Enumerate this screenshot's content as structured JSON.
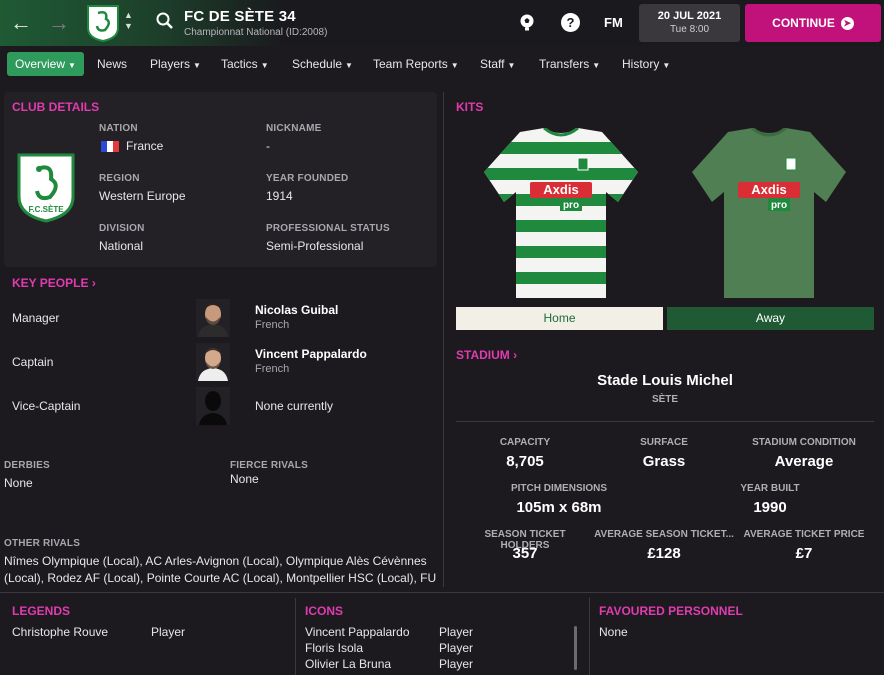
{
  "header": {
    "club_name": "FC DE SÈTE 34",
    "competition": "Championnat National (ID:2008)",
    "fm_label": "FM",
    "date": "20 JUL 2021",
    "day_time": "Tue 8:00",
    "continue_label": "CONTINUE"
  },
  "tabs": [
    {
      "label": "Overview"
    },
    {
      "label": "News"
    },
    {
      "label": "Players"
    },
    {
      "label": "Tactics"
    },
    {
      "label": "Schedule"
    },
    {
      "label": "Team Reports"
    },
    {
      "label": "Staff"
    },
    {
      "label": "Transfers"
    },
    {
      "label": "History"
    }
  ],
  "club_details": {
    "title": "CLUB DETAILS",
    "crest_text": "F.C.SÈTE",
    "nation_label": "NATION",
    "nation": "France",
    "nickname_label": "NICKNAME",
    "nickname": "-",
    "region_label": "REGION",
    "region": "Western Europe",
    "founded_label": "YEAR FOUNDED",
    "founded": "1914",
    "division_label": "DIVISION",
    "division": "National",
    "status_label": "PROFESSIONAL STATUS",
    "status": "Semi-Professional"
  },
  "key_people": {
    "title": "KEY PEOPLE",
    "people": [
      {
        "role": "Manager",
        "name": "Nicolas Guibal",
        "nationality": "French"
      },
      {
        "role": "Captain",
        "name": "Vincent Pappalardo",
        "nationality": "French"
      },
      {
        "role": "Vice-Captain",
        "name": "None currently",
        "nationality": ""
      }
    ]
  },
  "rivals": {
    "derbies_label": "DERBIES",
    "derbies": "None",
    "fierce_label": "FIERCE RIVALS",
    "fierce": "None",
    "other_label": "OTHER RIVALS",
    "other_line1": "Nîmes Olympique (Local), AC Arles-Avignon (Local), Olympique Alès Cévènnes",
    "other_line2": "(Local), Rodez AF (Local), Pointe Courte AC (Local), Montpellier HSC (Local), FU"
  },
  "kits": {
    "title": "KITS",
    "sponsor": "Axdis",
    "sponsor2": "pro",
    "home_label": "Home",
    "away_label": "Away",
    "colors": {
      "home_green": "#1f8a3e",
      "away_green": "#4f7f52",
      "sponsor_red": "#d92e36"
    }
  },
  "stadium": {
    "title": "STADIUM",
    "name": "Stade Louis Michel",
    "city": "SÈTE",
    "capacity_label": "CAPACITY",
    "capacity": "8,705",
    "surface_label": "SURFACE",
    "surface": "Grass",
    "condition_label": "STADIUM CONDITION",
    "condition": "Average",
    "pitch_label": "PITCH DIMENSIONS",
    "pitch": "105m x 68m",
    "built_label": "YEAR BUILT",
    "built": "1990",
    "season_ticket_label": "SEASON TICKET HOLDERS",
    "season_ticket": "357",
    "avg_season_label": "AVERAGE SEASON TICKET...",
    "avg_season": "£128",
    "avg_ticket_label": "AVERAGE TICKET PRICE",
    "avg_ticket": "£7"
  },
  "legends": {
    "title": "LEGENDS",
    "rows": [
      {
        "name": "Christophe Rouve",
        "role": "Player"
      }
    ]
  },
  "icons": {
    "title": "ICONS",
    "rows": [
      {
        "name": "Vincent Pappalardo",
        "role": "Player"
      },
      {
        "name": "Floris Isola",
        "role": "Player"
      },
      {
        "name": "Olivier La Bruna",
        "role": "Player"
      }
    ]
  },
  "favoured": {
    "title": "FAVOURED PERSONNEL",
    "value": "None"
  },
  "theme": {
    "accent": "#e13bb0",
    "active_tab": "#2e9a5b",
    "continue": "#c0127a"
  }
}
